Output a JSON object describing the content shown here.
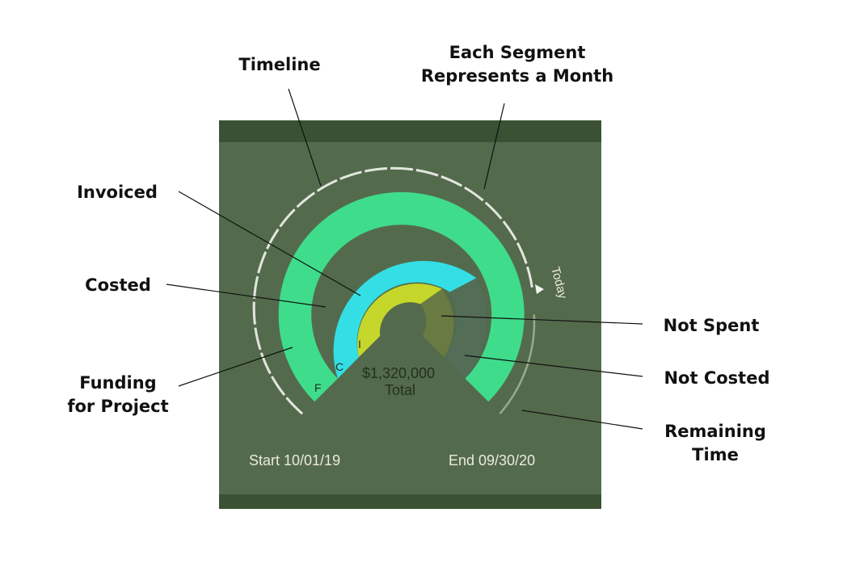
{
  "callouts": {
    "timeline": "Timeline",
    "segment_line1": "Each Segment",
    "segment_line2": "Represents a Month",
    "invoiced": "Invoiced",
    "costed": "Costed",
    "funding_line1": "Funding",
    "funding_line2": "for Project",
    "not_spent": "Not Spent",
    "not_costed": "Not Costed",
    "remaining_line1": "Remaining",
    "remaining_line2": "Time"
  },
  "widget": {
    "ring_letters": {
      "funding": "F",
      "costed": "C",
      "invoiced": "I"
    },
    "total_amount": "$1,320,000",
    "total_label": "Total",
    "today_label": "Today",
    "start_label": "Start 10/01/19",
    "end_label": "End 09/30/20"
  },
  "colors": {
    "panel_bg": "#536b4c",
    "panel_band": "#3a5233",
    "funding": "#3fdc8c",
    "costed": "#33dfe5",
    "invoiced": "#c5d72a",
    "not_spent": "#6a7a43",
    "not_costed": "#536d57",
    "timeline": "#e2e6de"
  }
}
